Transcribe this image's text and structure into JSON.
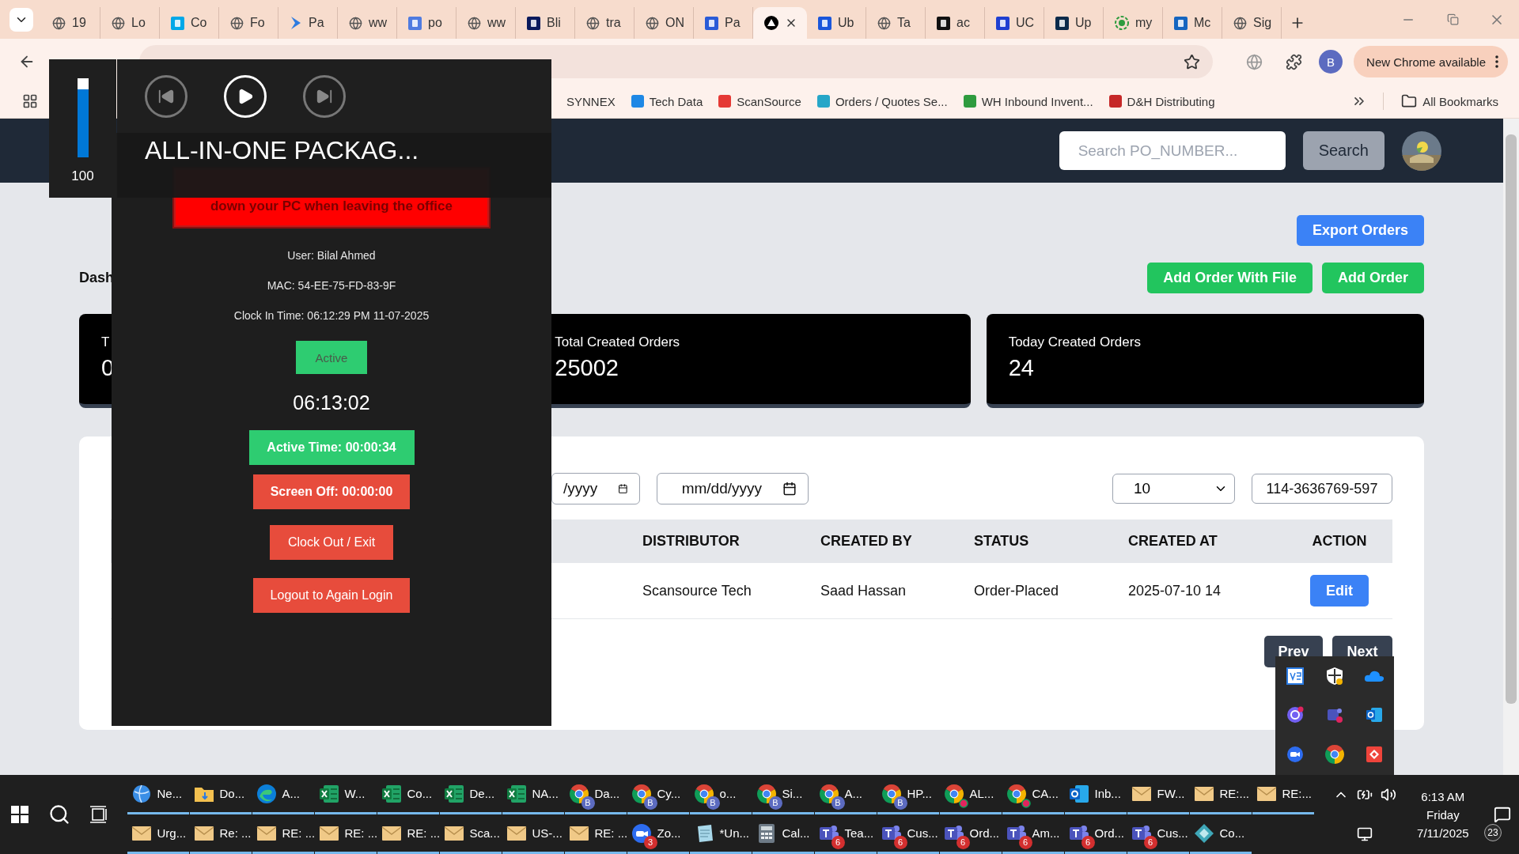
{
  "browser": {
    "tabs": [
      {
        "kind": "globe",
        "label": "19",
        "selected": false
      },
      {
        "kind": "globe",
        "label": "Lo",
        "selected": false
      },
      {
        "kind": "square",
        "color": "#00a8e8",
        "label": "Co",
        "selected": false
      },
      {
        "kind": "globe",
        "label": "Fo",
        "selected": false
      },
      {
        "kind": "chevron",
        "color": "#2f7ce0",
        "label": "Pa",
        "selected": false
      },
      {
        "kind": "globe",
        "label": "ww",
        "selected": false
      },
      {
        "kind": "square",
        "color": "#4f7be0",
        "label": "po",
        "selected": false
      },
      {
        "kind": "globe",
        "label": "ww",
        "selected": false
      },
      {
        "kind": "square",
        "color": "#0a1a5c",
        "label": "Bli",
        "selected": false
      },
      {
        "kind": "globe",
        "label": "tra",
        "selected": false
      },
      {
        "kind": "globe",
        "label": "ON",
        "selected": false
      },
      {
        "kind": "square",
        "color": "#2a5bd7",
        "label": "Pa",
        "selected": false
      },
      {
        "kind": "triangle",
        "selected": true
      },
      {
        "kind": "square",
        "color": "#1a56db",
        "label": "Ub",
        "selected": false
      },
      {
        "kind": "globe",
        "label": "Ta",
        "selected": false
      },
      {
        "kind": "square",
        "color": "#111111",
        "label": "ac",
        "selected": false
      },
      {
        "kind": "square",
        "color": "#1f3fd1",
        "label": "UC",
        "selected": false
      },
      {
        "kind": "square",
        "color": "#0b2a4a",
        "label": "Up",
        "selected": false
      },
      {
        "kind": "circle",
        "color": "#2e9b3e",
        "label": "my",
        "selected": false
      },
      {
        "kind": "square",
        "color": "#1565c0",
        "label": "Mc",
        "selected": false
      },
      {
        "kind": "globe",
        "label": "Sig",
        "selected": false
      }
    ],
    "profile_initial": "B",
    "update_label": "New Chrome available",
    "bookmarks": [
      {
        "label": "SYNNEX"
      },
      {
        "label": "Tech Data",
        "color": "#1e88e5"
      },
      {
        "label": "ScanSource",
        "color": "#e53935"
      },
      {
        "label": "Orders / Quotes Se...",
        "color": "#26a6c8"
      },
      {
        "label": "WH Inbound Invent...",
        "color": "#2e9b3e"
      },
      {
        "label": "D&H Distributing",
        "color": "#c62828"
      }
    ],
    "all_bookmarks": "All Bookmarks"
  },
  "app": {
    "search_placeholder": "Search PO_NUMBER...",
    "search_button": "Search",
    "export_button": "Export Orders",
    "title": "Dash",
    "add_file_button": "Add Order With File",
    "add_button": "Add Order",
    "stats": [
      {
        "label": "T",
        "value": "0"
      },
      {
        "label": "Total Created Orders",
        "value": "25002"
      },
      {
        "label": "Today Created Orders",
        "value": "24"
      }
    ],
    "filters": {
      "date_from": "/yyyy",
      "date_to": "mm/dd/yyyy",
      "page_size": "10",
      "search_value": "114-3636769-597"
    },
    "table": {
      "columns": [
        "DISTRIBUTOR",
        "CREATED BY",
        "STATUS",
        "CREATED AT",
        "ACTION"
      ],
      "rows": [
        {
          "cells": [
            "Scansource Tech",
            "Saad Hassan",
            "Order-Placed",
            "2025-07-10 14"
          ],
          "action": "Edit"
        }
      ]
    },
    "pagination": {
      "prev": "Prev",
      "next": "Next"
    }
  },
  "media_flyout": {
    "volume": {
      "level": 1,
      "reading": "100"
    },
    "title": "ALL-IN-ONE PACKAG..."
  },
  "tracker": {
    "banner": "down your PC when leaving the office",
    "user": "User: Bilal Ahmed",
    "mac": "MAC: 54-EE-75-FD-83-9F",
    "clock_in": "Clock In Time: 06:12:29 PM 11-07-2025",
    "status": "Active",
    "clock": "06:13:02",
    "active_time": "Active Time: 00:00:34",
    "screen_off": "Screen Off: 00:00:00",
    "clock_out": "Clock Out / Exit",
    "logout": "Logout to Again Login"
  },
  "taskbar": {
    "row_1": [
      {
        "kind": "network",
        "label": "Ne..."
      },
      {
        "kind": "folder",
        "label": "Do..."
      },
      {
        "kind": "edge",
        "label": "A..."
      },
      {
        "kind": "excel",
        "label": "W..."
      },
      {
        "kind": "excel",
        "label": "Co..."
      },
      {
        "kind": "excel",
        "label": "De..."
      },
      {
        "kind": "excel",
        "label": "NA..."
      },
      {
        "kind": "chrome",
        "badge": "B",
        "label": "Da..."
      },
      {
        "kind": "chrome",
        "badge": "B",
        "label": "Cy..."
      },
      {
        "kind": "chrome",
        "badge": "B",
        "label": "o..."
      },
      {
        "kind": "chrome",
        "badge": "B",
        "label": "Si..."
      },
      {
        "kind": "chrome",
        "badge": "B",
        "label": "A..."
      },
      {
        "kind": "chrome",
        "badge": "B",
        "label": "HP..."
      },
      {
        "kind": "chrome-alert",
        "label": "AL..."
      },
      {
        "kind": "chrome-alert",
        "label": "CA..."
      },
      {
        "kind": "outlook",
        "label": "Inb..."
      },
      {
        "kind": "mail",
        "label": "FW..."
      },
      {
        "kind": "mail",
        "label": "RE:..."
      },
      {
        "kind": "mail",
        "label": "RE:..."
      }
    ],
    "row_2": [
      {
        "kind": "mail",
        "label": "Urg..."
      },
      {
        "kind": "mail",
        "label": "Re: ..."
      },
      {
        "kind": "mail",
        "label": "RE: ..."
      },
      {
        "kind": "mail",
        "label": "RE: ..."
      },
      {
        "kind": "mail",
        "label": "RE: ..."
      },
      {
        "kind": "mail",
        "label": "Sca..."
      },
      {
        "kind": "mail",
        "label": "US-..."
      },
      {
        "kind": "mail",
        "label": "RE: ..."
      },
      {
        "kind": "zoom",
        "badge": "3",
        "label": "Zo..."
      },
      {
        "kind": "notepad",
        "label": "*Un..."
      },
      {
        "kind": "calculator",
        "label": "Cal..."
      },
      {
        "kind": "teams",
        "badge": "6",
        "label": "Tea..."
      },
      {
        "kind": "teams",
        "badge": "6",
        "label": "Cus..."
      },
      {
        "kind": "teams",
        "badge": "6",
        "label": "Ord..."
      },
      {
        "kind": "teams",
        "badge": "6",
        "label": "Am..."
      },
      {
        "kind": "teams",
        "badge": "6",
        "label": "Ord..."
      },
      {
        "kind": "teams",
        "badge": "6",
        "label": "Cus..."
      },
      {
        "kind": "app",
        "label": "Co..."
      }
    ],
    "clock": {
      "time": "6:13 AM",
      "day": "Friday",
      "date": "7/11/2025"
    },
    "notifications": "23"
  }
}
